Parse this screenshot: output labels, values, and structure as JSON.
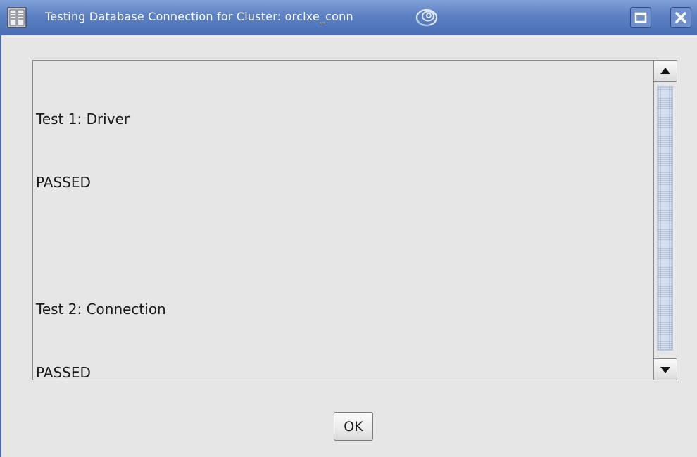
{
  "window": {
    "title": "Testing Database Connection for Cluster: orclxe_conn"
  },
  "icons": {
    "app": "database-app-icon",
    "swirl": "compiz-swirl-icon",
    "maximize": "maximize-icon",
    "close": "close-icon",
    "scroll_up": "arrow-up-icon",
    "scroll_down": "arrow-down-icon"
  },
  "output": {
    "lines": [
      "Test 1: Driver",
      "PASSED",
      "",
      "Test 2: Connection",
      "PASSED"
    ]
  },
  "buttons": {
    "ok_label": "OK"
  },
  "colors": {
    "titlebar": "#5d81c4",
    "title_text": "#ffffff",
    "window_bg": "#e6e6e6",
    "scroll_thumb": "#d9e2ef"
  }
}
